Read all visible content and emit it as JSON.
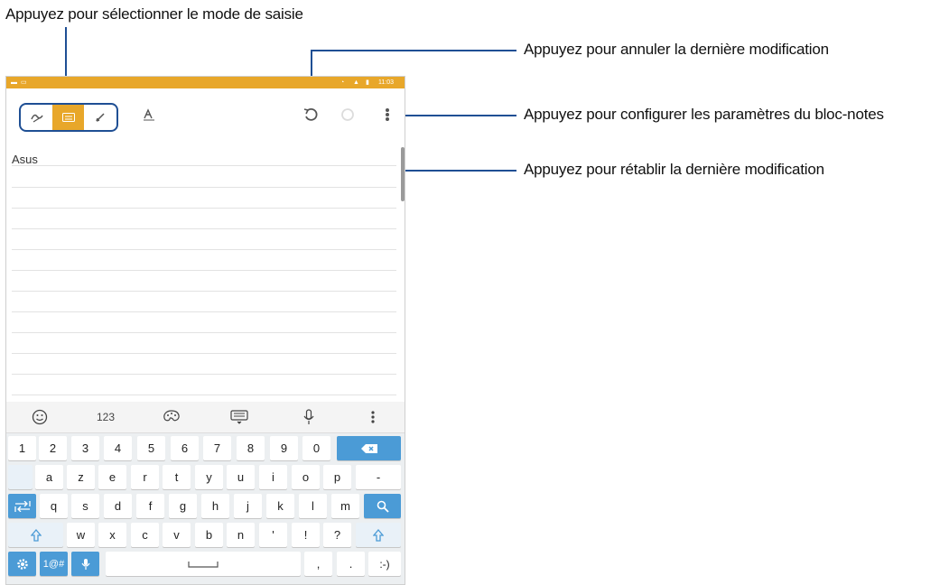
{
  "callouts": {
    "select_mode": "Appuyez pour sélectionner le mode de saisie",
    "undo": "Appuyez pour annuler la dernière modification",
    "settings": "Appuyez pour configurer les paramètres du bloc-notes",
    "redo": "Appuyez pour rétablir la dernière modification"
  },
  "colors": {
    "accent": "#e8a72a",
    "callout_line": "#1f4f94",
    "key_blue": "#4b9bd6"
  },
  "status_bar": {
    "time": "11:03"
  },
  "toolbar": {
    "modes": [
      "handwriting-icon",
      "keyboard-icon",
      "pen-icon"
    ],
    "selected_mode": "keyboard-icon"
  },
  "note": {
    "text": "Asus"
  },
  "keyboard": {
    "toolbar": {
      "numbers_label": "123"
    },
    "row1": [
      "1",
      "2",
      "3",
      "4",
      "5",
      "6",
      "7",
      "8",
      "9",
      "0"
    ],
    "row2": [
      "a",
      "z",
      "e",
      "r",
      "t",
      "y",
      "u",
      "i",
      "o",
      "p",
      "-"
    ],
    "row3": [
      "q",
      "s",
      "d",
      "f",
      "g",
      "h",
      "j",
      "k",
      "l",
      "m"
    ],
    "row4": [
      "w",
      "x",
      "c",
      "v",
      "b",
      "n",
      "'",
      "!",
      "?"
    ],
    "sym_label": "1@#",
    "comma": ",",
    "period": ".",
    "smiley": ":-)"
  }
}
